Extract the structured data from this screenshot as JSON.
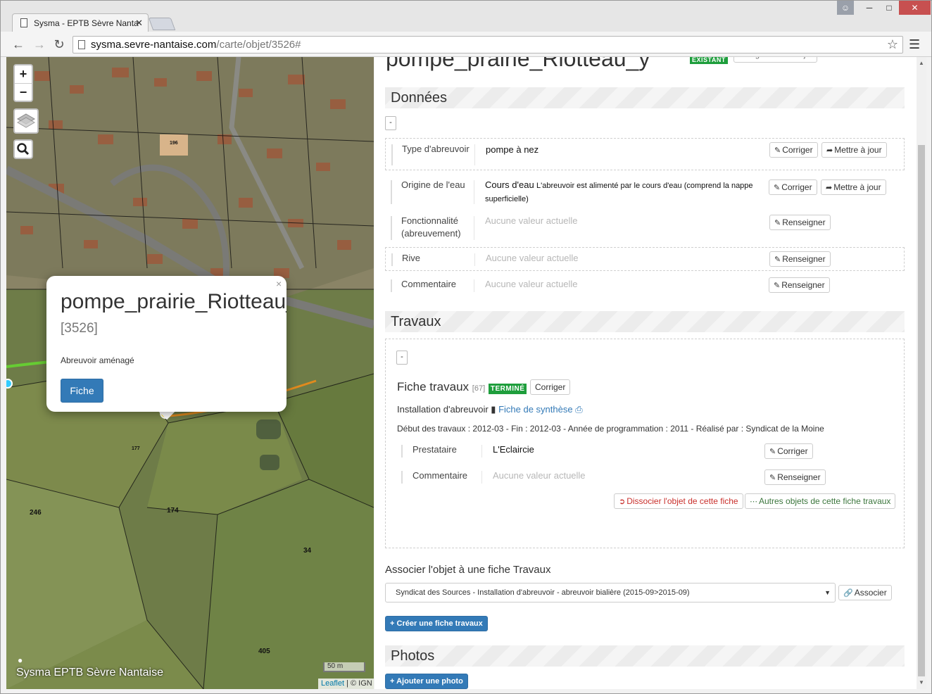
{
  "browser": {
    "tab_title": "Sysma - EPTB Sèvre Nanta",
    "url_host": "sysma.sevre-nantaise.com",
    "url_path": "/carte/objet/3526#"
  },
  "map": {
    "zoom_in": "+",
    "zoom_out": "−",
    "popup": {
      "title": "pompe_prairie_Riotteau_",
      "id": "[3526]",
      "type": "Abreuvoir aménagé",
      "button": "Fiche",
      "close": "×"
    },
    "parcel_labels": [
      "246",
      "174",
      "34",
      "405",
      "177",
      "196"
    ],
    "footer": "Sysma EPTB Sèvre Nantaise",
    "scale": "50 m",
    "attribution_link": "Leaflet",
    "attribution_sep": " | © ",
    "attribution_ign": "IGN"
  },
  "object": {
    "title": "pompe_prairie_Riotteau_y",
    "status": "EXISTANT",
    "edit_button": "Corriger la fiche objet"
  },
  "donnees": {
    "heading": "Données",
    "toggle": "-",
    "rows": [
      {
        "label": "Type d'abreuvoir",
        "value_main": "pompe à nez",
        "value_detail": "",
        "btn1": "Corriger",
        "btn2": "Mettre à jour"
      },
      {
        "label": "Origine de l'eau",
        "value_main": "Cours d'eau",
        "value_detail": "L'abreuvoir est alimenté par le cours d'eau (comprend la nappe superficielle)",
        "btn1": "Corriger",
        "btn2": "Mettre à jour"
      },
      {
        "label": "Fonctionnalité (abreuvement)",
        "value_empty": "Aucune valeur actuelle",
        "btn1": "Renseigner"
      },
      {
        "label": "Rive",
        "value_empty": "Aucune valeur actuelle",
        "btn1": "Renseigner"
      },
      {
        "label": "Commentaire",
        "value_empty": "Aucune valeur actuelle",
        "btn1": "Renseigner"
      }
    ]
  },
  "travaux": {
    "heading": "Travaux",
    "toggle": "-",
    "fiche_title": "Fiche travaux",
    "fiche_num": "[67]",
    "fiche_status": "TERMINÉ",
    "fiche_edit": "Corriger",
    "install_label": "Installation d'abreuvoir",
    "synthese_link": "Fiche de synthèse",
    "dates_line": "Début des travaux : 2012-03 - Fin : 2012-03 - Année de programmation : 2011 - Réalisé par : Syndicat de la Moine",
    "rows": [
      {
        "label": "Prestataire",
        "value_main": "L'Eclaircie",
        "btn1": "Corriger"
      },
      {
        "label": "Commentaire",
        "value_empty": "Aucune valeur actuelle",
        "btn1": "Renseigner"
      }
    ],
    "dissocier": "Dissocier l'objet de cette fiche",
    "autres": "Autres objets de cette fiche travaux"
  },
  "associer": {
    "title": "Associer l'objet à une fiche Travaux",
    "select_value": "Syndicat des Sources - Installation d'abreuvoir - abreuvoir bialière (2015-09>2015-09)",
    "button": "Associer",
    "create_button": "Créer une fiche travaux"
  },
  "photos": {
    "heading": "Photos",
    "add_button": "Ajouter une photo"
  }
}
